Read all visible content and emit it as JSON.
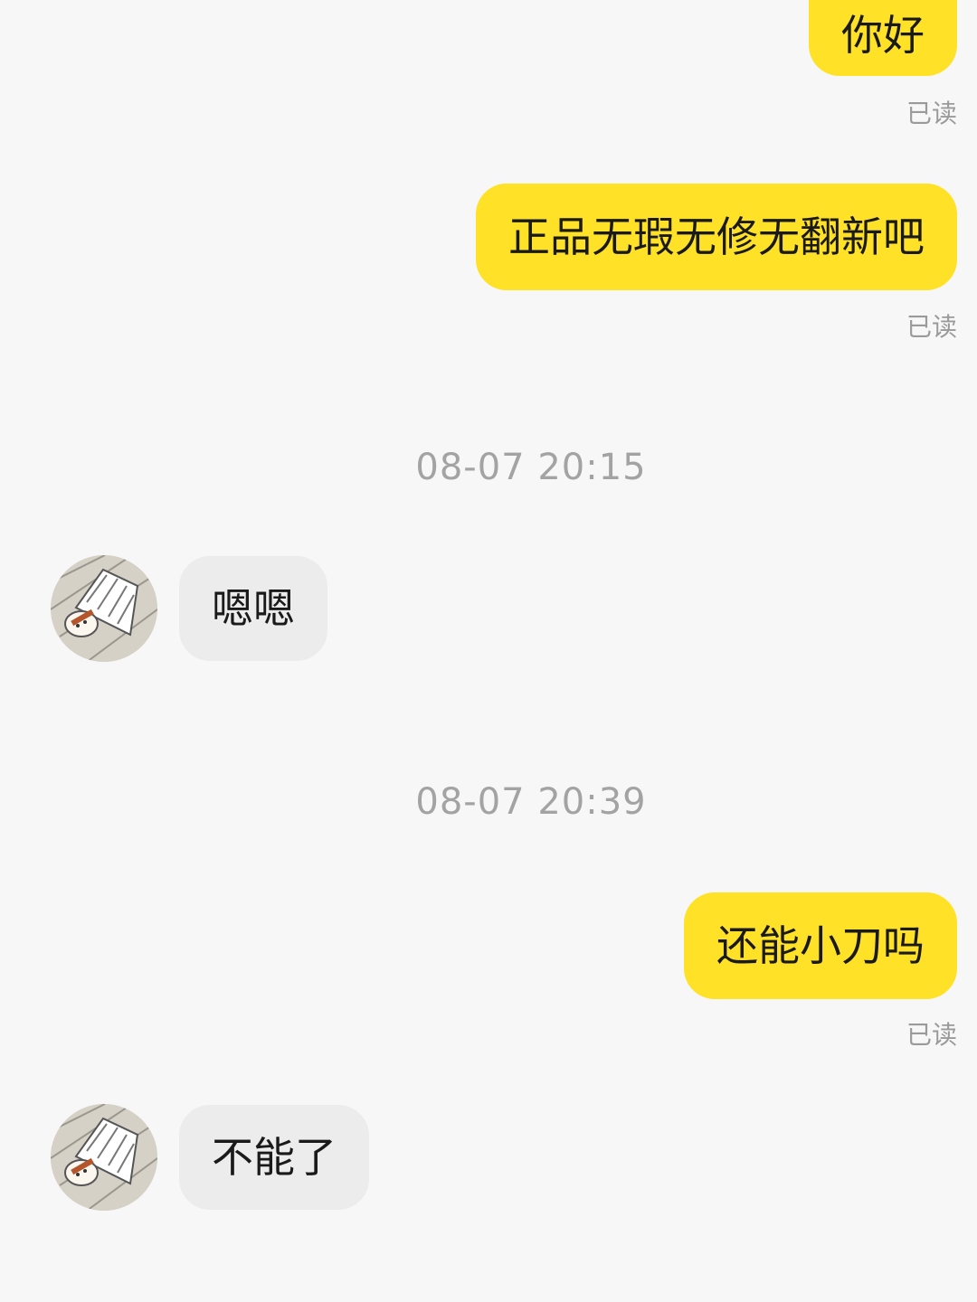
{
  "messages": [
    {
      "side": "out",
      "text": "你好",
      "status": "已读"
    },
    {
      "side": "out",
      "text": "正品无瑕无修无翻新吧",
      "status": "已读"
    },
    {
      "type": "timestamp",
      "text": "08-07 20:15"
    },
    {
      "side": "in",
      "text": "嗯嗯"
    },
    {
      "type": "timestamp",
      "text": "08-07 20:39"
    },
    {
      "side": "out",
      "text": "还能小刀吗",
      "status": "已读"
    },
    {
      "side": "in",
      "text": "不能了"
    }
  ],
  "colors": {
    "outgoing_bubble": "#ffe227",
    "incoming_bubble": "#ececec",
    "background": "#f7f7f7",
    "meta_text": "#a3a3a3"
  },
  "avatar": {
    "icon": "shuttlecock-cartoon-avatar"
  }
}
